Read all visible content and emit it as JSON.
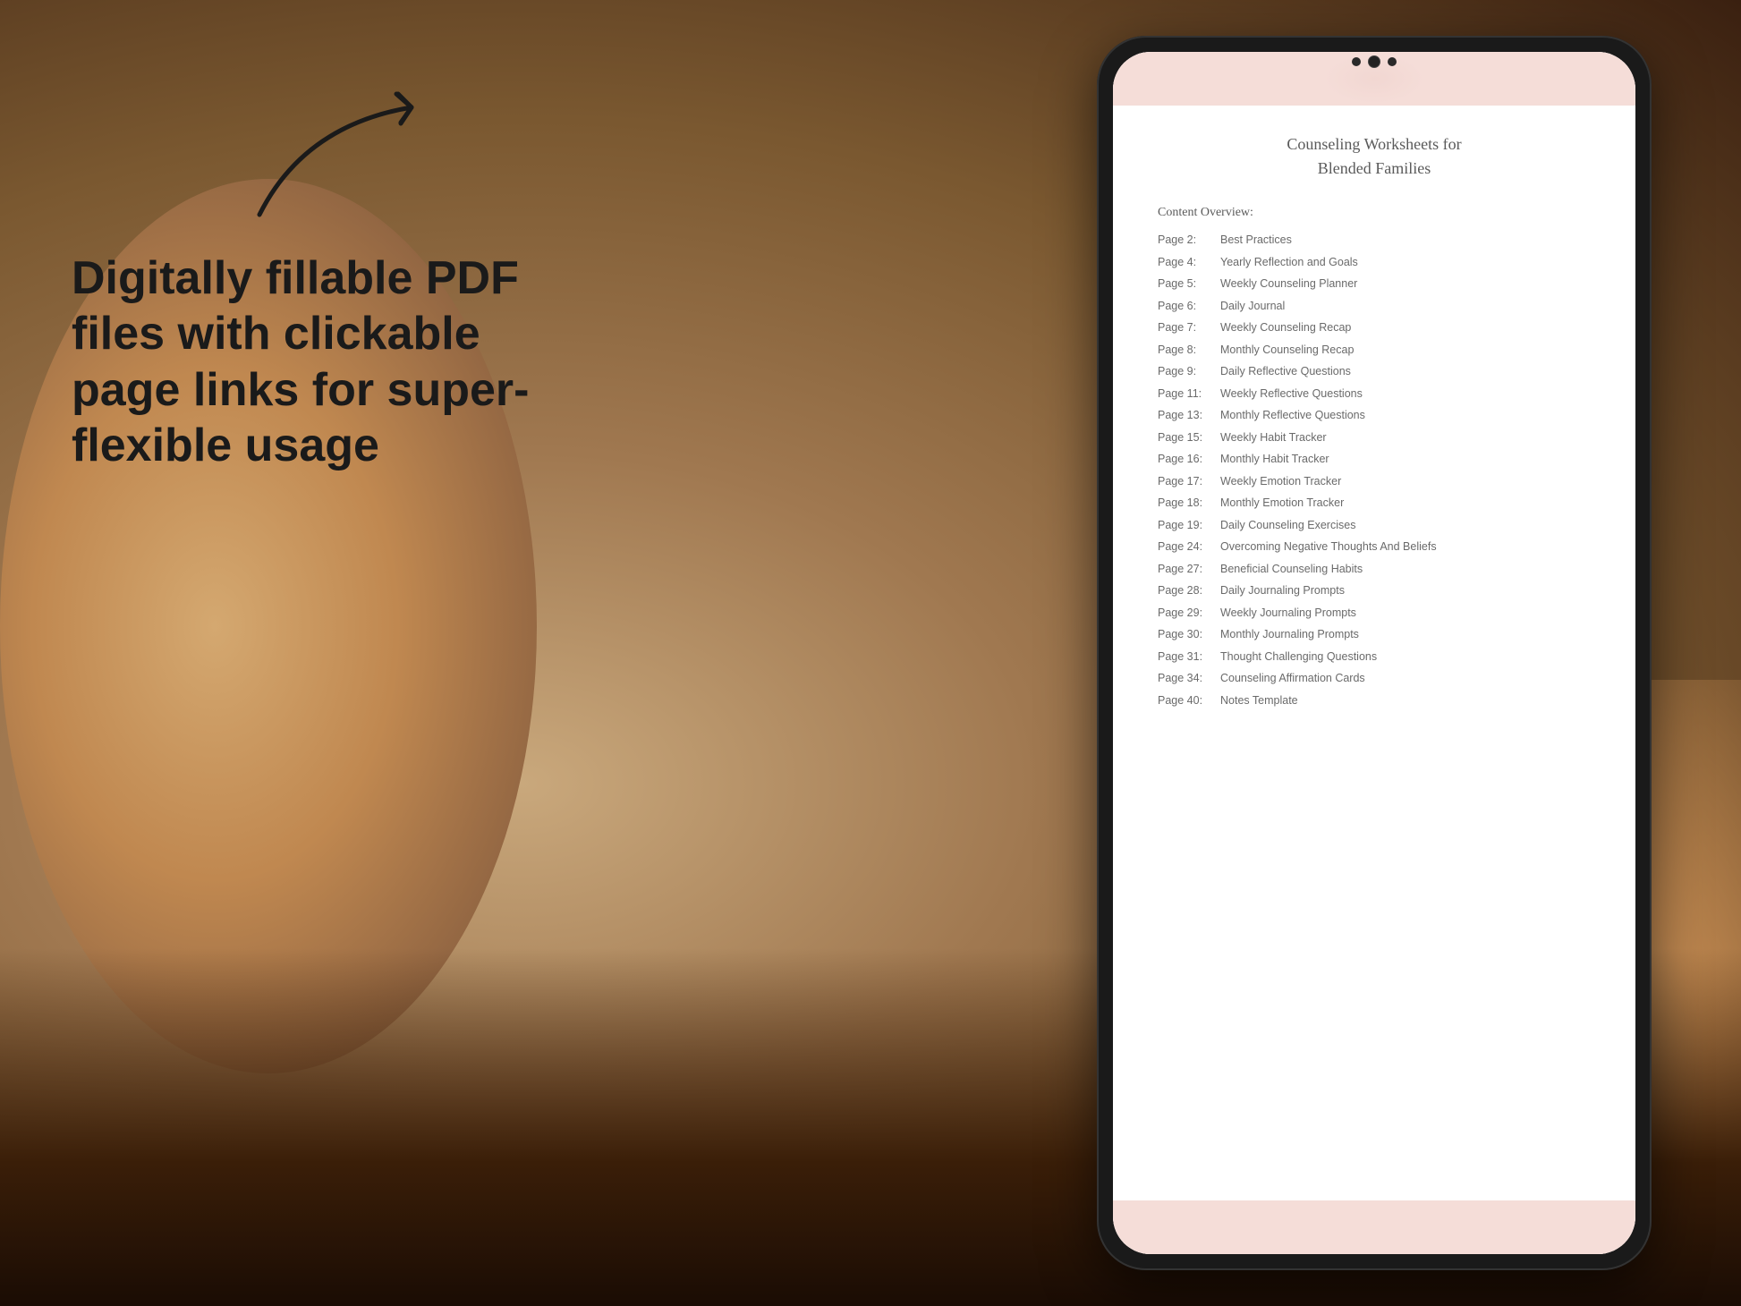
{
  "background": {
    "color": "#b8956a"
  },
  "left_text": {
    "tagline": "Digitally fillable PDF files with clickable page links for super-flexible usage"
  },
  "arrow": {
    "label": "arrow pointing to tablet"
  },
  "tablet": {
    "title_line1": "Counseling Worksheets for",
    "title_line2": "Blended Families",
    "section_label": "Content Overview:",
    "toc_items": [
      {
        "page": "Page 2:",
        "title": "Best Practices"
      },
      {
        "page": "Page 4:",
        "title": "Yearly Reflection and Goals"
      },
      {
        "page": "Page 5:",
        "title": "Weekly Counseling Planner"
      },
      {
        "page": "Page 6:",
        "title": "Daily Journal"
      },
      {
        "page": "Page 7:",
        "title": "Weekly Counseling Recap"
      },
      {
        "page": "Page 8:",
        "title": "Monthly Counseling Recap"
      },
      {
        "page": "Page 9:",
        "title": "Daily Reflective Questions"
      },
      {
        "page": "Page 11:",
        "title": "Weekly Reflective Questions"
      },
      {
        "page": "Page 13:",
        "title": "Monthly Reflective Questions"
      },
      {
        "page": "Page 15:",
        "title": "Weekly Habit Tracker"
      },
      {
        "page": "Page 16:",
        "title": "Monthly Habit Tracker"
      },
      {
        "page": "Page 17:",
        "title": "Weekly Emotion Tracker"
      },
      {
        "page": "Page 18:",
        "title": "Monthly Emotion Tracker"
      },
      {
        "page": "Page 19:",
        "title": "Daily Counseling Exercises"
      },
      {
        "page": "Page 24:",
        "title": "Overcoming Negative Thoughts And Beliefs"
      },
      {
        "page": "Page 27:",
        "title": "Beneficial Counseling Habits"
      },
      {
        "page": "Page 28:",
        "title": "Daily Journaling Prompts"
      },
      {
        "page": "Page 29:",
        "title": "Weekly Journaling Prompts"
      },
      {
        "page": "Page 30:",
        "title": "Monthly Journaling Prompts"
      },
      {
        "page": "Page 31:",
        "title": "Thought Challenging Questions"
      },
      {
        "page": "Page 34:",
        "title": "Counseling Affirmation Cards"
      },
      {
        "page": "Page 40:",
        "title": "Notes Template"
      }
    ]
  }
}
